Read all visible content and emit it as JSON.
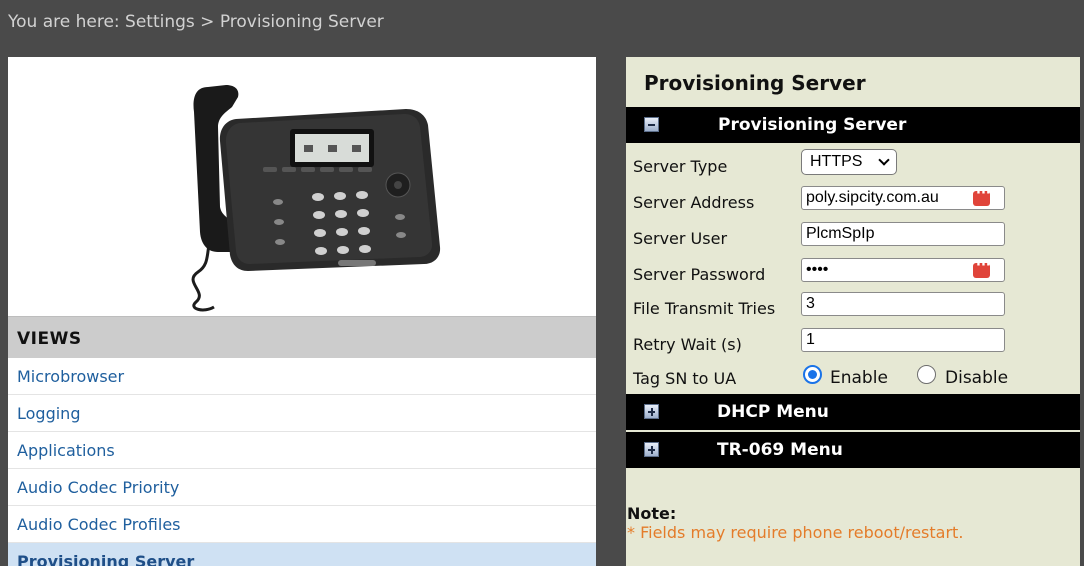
{
  "breadcrumb": "You are here: Settings > Provisioning Server",
  "left": {
    "views_header": "VIEWS",
    "nav_items": [
      {
        "label": "Microbrowser"
      },
      {
        "label": "Logging"
      },
      {
        "label": "Applications"
      },
      {
        "label": "Audio Codec Priority"
      },
      {
        "label": "Audio Codec Profiles"
      },
      {
        "label": "Provisioning Server",
        "active": true
      }
    ]
  },
  "right": {
    "page_title": "Provisioning Server",
    "section_provisioning": "Provisioning Server",
    "fields": {
      "server_type_label": "Server Type",
      "server_type_value": "HTTPS",
      "server_address_label": "Server Address",
      "server_address_value": "poly.sipcity.com.au",
      "server_user_label": "Server User",
      "server_user_value": "PlcmSpIp",
      "server_password_label": "Server Password",
      "server_password_value": "••••",
      "file_transmit_label": "File Transmit Tries",
      "file_transmit_value": "3",
      "retry_wait_label": "Retry Wait (s)",
      "retry_wait_value": "1",
      "tag_sn_label": "Tag SN to UA",
      "tag_sn_enable": "Enable",
      "tag_sn_disable": "Disable",
      "tag_sn_selected": "Enable"
    },
    "section_dhcp": "DHCP Menu",
    "section_tr069": "TR-069 Menu",
    "note_title": "Note:",
    "note_text": "* Fields may require phone reboot/restart."
  },
  "colors": {
    "top_bar": "#4a4a4a",
    "right_panel_bg": "#e6e8d4",
    "section_bar": "#000000",
    "nav_link": "#1f5f9e",
    "nav_active_bg": "#cfe1f3",
    "note_text": "#e47c2a",
    "radio_accent": "#1a73e8"
  },
  "icons": {
    "collapse": "minus-toggle-icon",
    "expand": "plus-toggle-icon",
    "password_manager": "password-manager-icon"
  }
}
